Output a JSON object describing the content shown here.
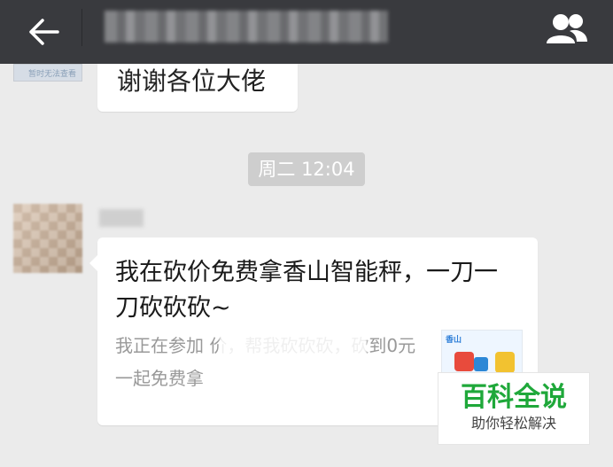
{
  "header": {
    "back_icon": "arrow-left-icon",
    "contacts_icon": "contacts-icon",
    "background": "#393a3e"
  },
  "previous_message": {
    "thumb_text": "暂时无法查看",
    "text": "谢谢各位大佬"
  },
  "timestamp": "周二 12:04",
  "link_message": {
    "title": "我在砍价免费拿香山智能秤，一刀一刀砍砍砍~",
    "description": "我正在参加                     价，帮我砍砍砍，砍到0元一起免费拿",
    "thumbnail_brand": "香山"
  },
  "watermark": {
    "title": "百科全说",
    "subtitle": "助你轻松解决",
    "color": "#1fa83a"
  }
}
